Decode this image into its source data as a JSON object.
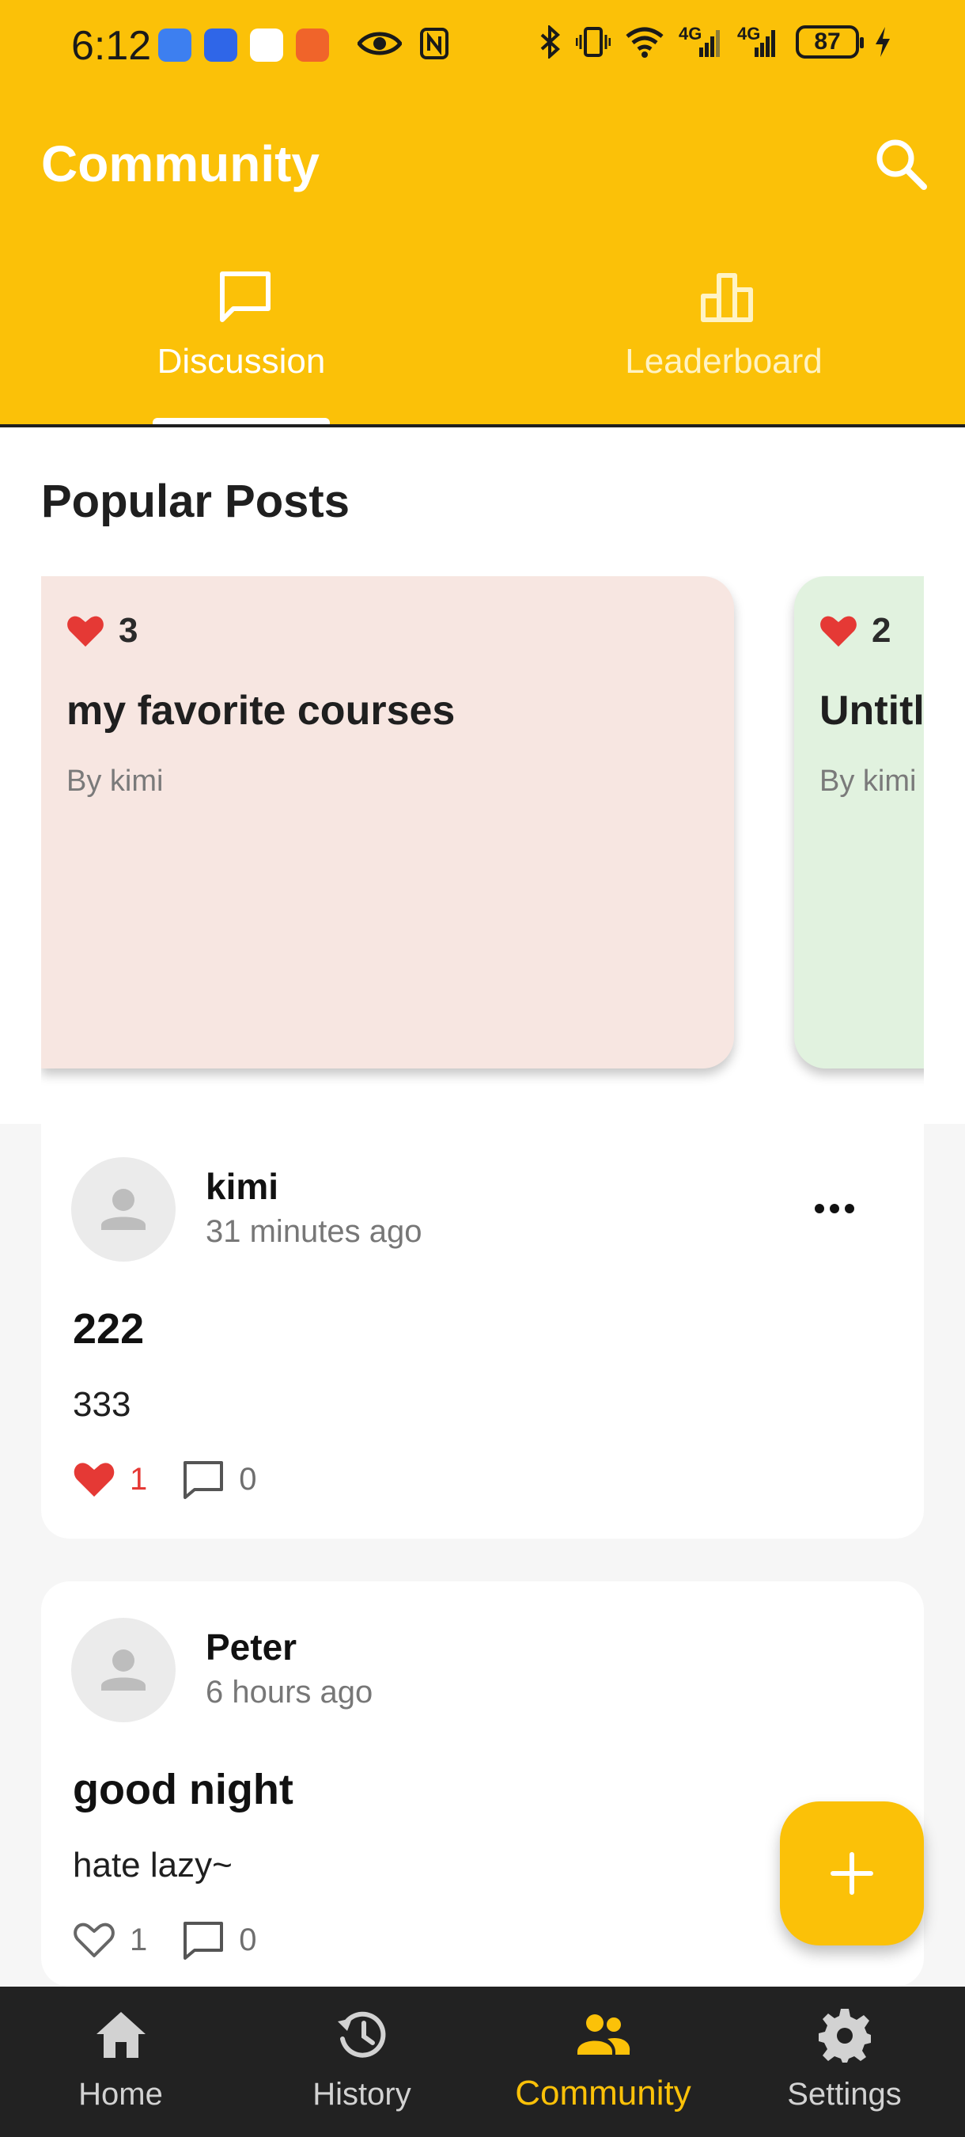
{
  "colors": {
    "accent": "#fbc108",
    "header_text": "#ffffff",
    "like_red": "#e53935",
    "nav_bg": "#222222"
  },
  "status_bar": {
    "time": "6:12",
    "battery": "87",
    "network_1": "4G",
    "network_2": "4G"
  },
  "app_bar": {
    "title": "Community",
    "search_icon": "search-icon"
  },
  "tabs": [
    {
      "label": "Discussion",
      "icon": "chat-bubble-icon",
      "selected": true
    },
    {
      "label": "Leaderboard",
      "icon": "bar-chart-icon",
      "selected": false
    }
  ],
  "popular": {
    "title": "Popular Posts",
    "cards": [
      {
        "likes": "3",
        "title": "my favorite courses",
        "author": "By kimi"
      },
      {
        "likes": "2",
        "title": "Untitled",
        "author": "By kimi"
      }
    ]
  },
  "posts": [
    {
      "user": "kimi",
      "time": "31 minutes ago",
      "title": "222",
      "body": "333",
      "likes": "1",
      "liked": true,
      "comments": "0",
      "has_menu": true
    },
    {
      "user": "Peter",
      "time": "6 hours ago",
      "title": "good night",
      "body": "hate lazy~",
      "likes": "1",
      "liked": false,
      "comments": "0",
      "has_menu": false
    }
  ],
  "fab": {
    "icon": "plus-icon"
  },
  "bottom_nav": [
    {
      "label": "Home",
      "icon": "home-icon"
    },
    {
      "label": "History",
      "icon": "history-icon"
    },
    {
      "label": "Community",
      "icon": "people-icon",
      "active": true
    },
    {
      "label": "Settings",
      "icon": "gear-icon"
    }
  ]
}
